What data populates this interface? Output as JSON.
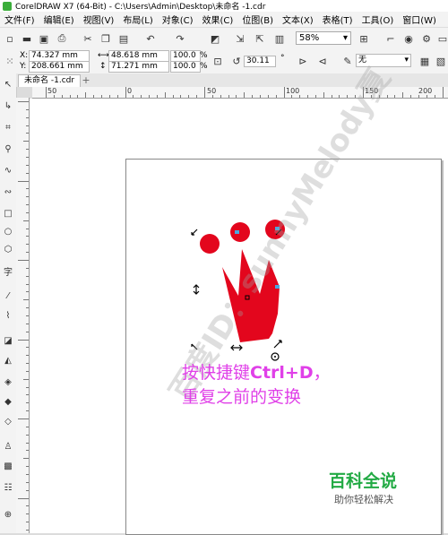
{
  "window": {
    "title": "CorelDRAW X7 (64-Bit) - C:\\Users\\Admin\\Desktop\\未命名 -1.cdr"
  },
  "menu": [
    "文件(F)",
    "编辑(E)",
    "视图(V)",
    "布局(L)",
    "对象(C)",
    "效果(C)",
    "位图(B)",
    "文本(X)",
    "表格(T)",
    "工具(O)",
    "窗口(W)"
  ],
  "toolbar": {
    "zoom": "58%"
  },
  "propbar": {
    "x_label": "X:",
    "x": "74.327 mm",
    "y_label": "Y:",
    "y": "208.661 mm",
    "w": "48.618 mm",
    "h": "71.271 mm",
    "scale_w": "100.0",
    "scale_h": "100.0",
    "pct": "%",
    "rotation": "30.11",
    "outline": "无"
  },
  "tab": {
    "label": "未命名 -1.cdr"
  },
  "ruler": {
    "h_labels": [
      "50",
      "0",
      "50",
      "100",
      "150",
      "200"
    ]
  },
  "caption": {
    "line1a": "按快捷键",
    "line1b": "Ctrl+D",
    "line1c": "，",
    "line2": "重复之前的变换"
  },
  "brand": {
    "name": "百科全说",
    "tagline": "助你轻松解决"
  },
  "watermark": {
    "text": "百度ID：sunnyMelody夏"
  },
  "colors": {
    "shape_red": "#e3061d",
    "caption": "#e040e8",
    "brand": "#22aa44"
  }
}
